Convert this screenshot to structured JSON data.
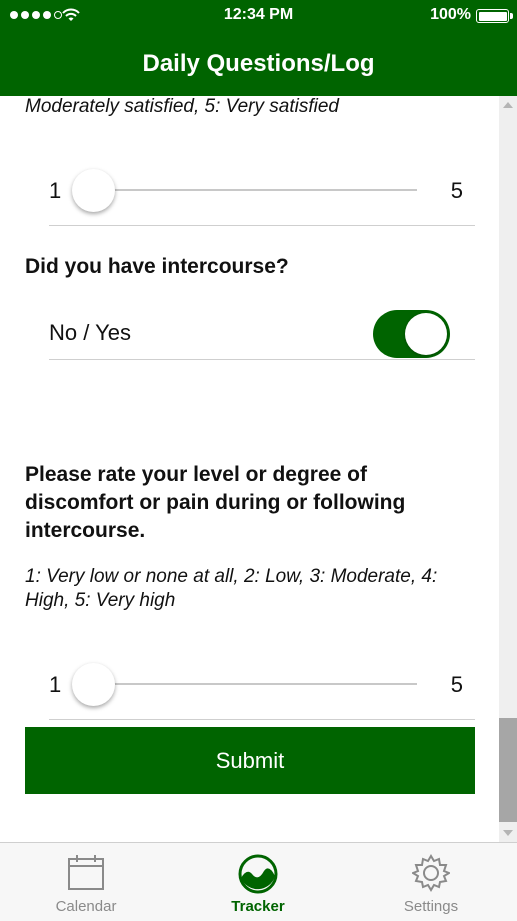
{
  "status_bar": {
    "time": "12:34 PM",
    "battery": "100%"
  },
  "header": {
    "title": "Daily Questions/Log"
  },
  "satisfaction": {
    "scale_text": "Moderately satisfied, 5: Very satisfied",
    "slider": {
      "min_label": "1",
      "max_label": "5",
      "value": 1
    }
  },
  "intercourse": {
    "question": "Did you have intercourse?",
    "toggle_label": "No / Yes",
    "toggle_on": true
  },
  "pain": {
    "question": "Please rate your level or degree of discomfort or pain during or following intercourse.",
    "scale_text": "1: Very low or none at all, 2: Low, 3: Moderate, 4: High, 5: Very high",
    "slider": {
      "min_label": "1",
      "max_label": "5",
      "value": 1
    }
  },
  "submit_label": "Submit",
  "tabs": [
    {
      "label": "Calendar",
      "icon": "calendar-icon",
      "active": false
    },
    {
      "label": "Tracker",
      "icon": "tracker-icon",
      "active": true
    },
    {
      "label": "Settings",
      "icon": "gear-icon",
      "active": false
    }
  ],
  "colors": {
    "brand_green": "#006400",
    "inactive_tab": "#8a8a8a"
  }
}
